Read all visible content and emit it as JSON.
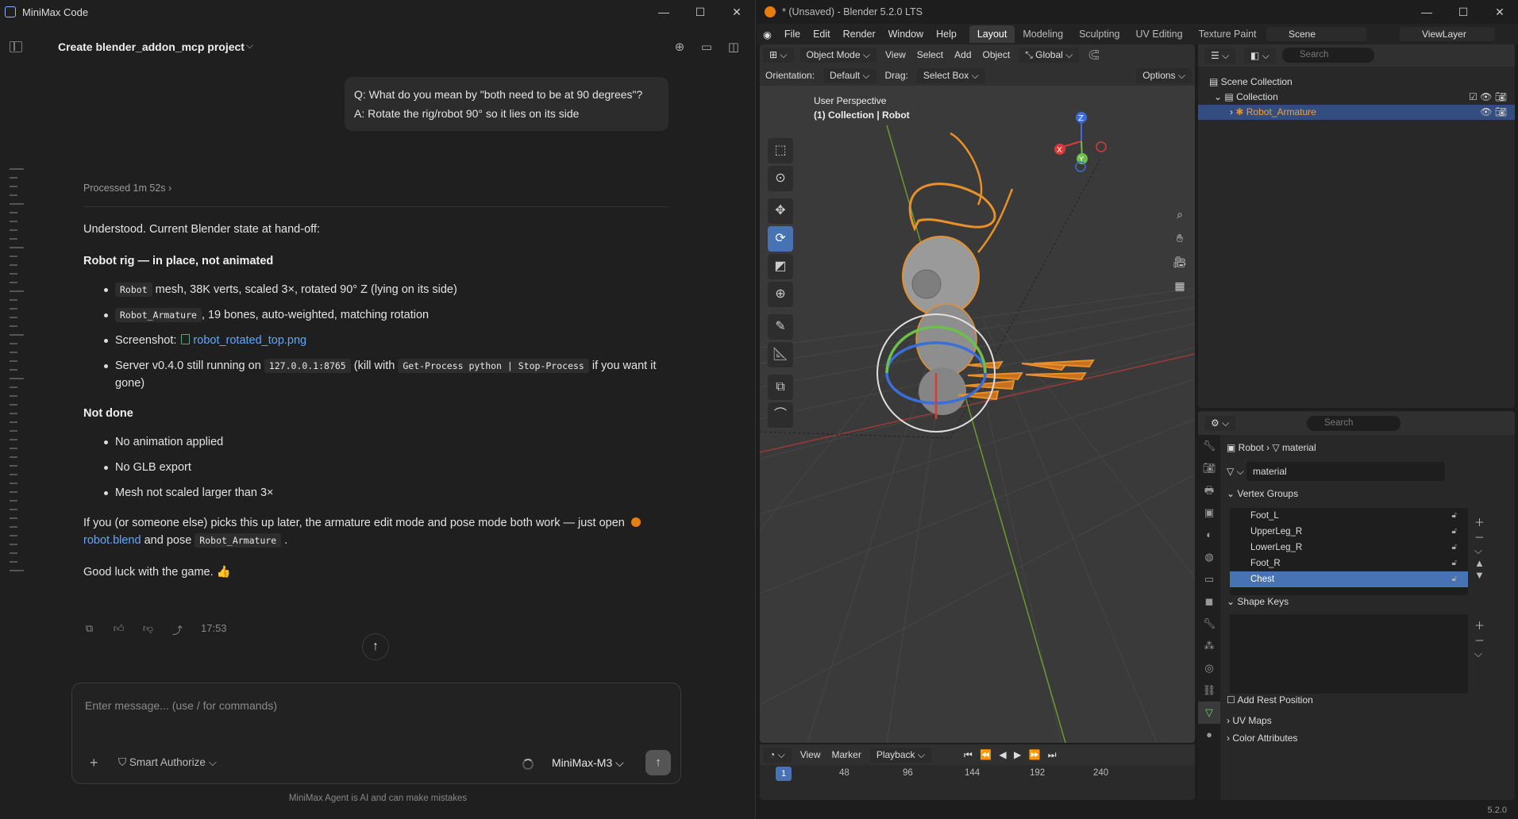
{
  "minimax": {
    "window_title": "MiniMax Code",
    "project_title": "Create blender_addon_mcp project",
    "user_message_q": "Q: What do you mean by \"both need to be at 90 degrees\"?",
    "user_message_a": "A: Rotate the rig/robot 90° so it lies on its side",
    "processed": "Processed 1m 52s",
    "intro": "Understood. Current Blender state at hand-off:",
    "section1": "Robot rig — in place, not animated",
    "b1_code": "Robot",
    "b1_text": "mesh, 38K verts, scaled 3×, rotated 90° Z (lying on its side)",
    "b2_code": "Robot_Armature",
    "b2_text": ", 19 bones, auto-weighted, matching rotation",
    "b3_label": "Screenshot:",
    "b3_link": "robot_rotated_top.png",
    "b4_pre": "Server v0.4.0 still running on",
    "b4_code1": "127.0.0.1:8765",
    "b4_mid": "(kill with",
    "b4_code2": "Get-Process python | Stop-Process",
    "b4_post": "if you want it gone)",
    "section2": "Not done",
    "nd1": "No animation applied",
    "nd2": "No GLB export",
    "nd3": "Mesh not scaled larger than 3×",
    "para_pre": "If you (or someone else) picks this up later, the armature edit mode and pose mode both work — just open",
    "para_link": "robot.blend",
    "para_mid": "and pose",
    "para_code": "Robot_Armature",
    "para_end": ".",
    "good_luck": "Good luck with the game. 👍",
    "time": "17:53",
    "input_placeholder": "Enter message... (use / for commands)",
    "smart_authorize": "Smart Authorize",
    "model": "MiniMax-M3",
    "disclaimer": "MiniMax Agent is AI and can make mistakes"
  },
  "blender": {
    "title": "* (Unsaved) - Blender 5.2.0 LTS",
    "menus": [
      "File",
      "Edit",
      "Render",
      "Window",
      "Help"
    ],
    "workspaces": [
      "Layout",
      "Modeling",
      "Sculpting",
      "UV Editing",
      "Texture Paint"
    ],
    "scene": "Scene",
    "view_layer": "ViewLayer",
    "mode": "Object Mode",
    "vp_menus": [
      "View",
      "Select",
      "Add",
      "Object"
    ],
    "transform": "Global",
    "orientation_label": "Orientation:",
    "orientation": "Default",
    "drag_label": "Drag:",
    "drag": "Select Box",
    "options": "Options",
    "vp_line1": "User Perspective",
    "vp_line2": "(1) Collection | Robot",
    "outliner_search": "Search",
    "scene_collection": "Scene Collection",
    "collection": "Collection",
    "armature": "Robot_Armature",
    "props_search": "Search",
    "bc_object": "Robot",
    "bc_data": "material",
    "data_name": "material",
    "vertex_groups": "Vertex Groups",
    "vg": [
      "Foot_L",
      "UpperLeg_R",
      "LowerLeg_R",
      "Foot_R",
      "Chest"
    ],
    "shape_keys": "Shape Keys",
    "add_rest": "Add Rest Position",
    "uv_maps": "UV Maps",
    "color_attrs": "Color Attributes",
    "tl_menus": [
      "View",
      "Marker",
      "Playback"
    ],
    "frame_current": "1",
    "frames": [
      "48",
      "96",
      "144",
      "192",
      "240"
    ],
    "version": "5.2.0",
    "accent": "#4772b3",
    "orange": "#e87d0d"
  }
}
